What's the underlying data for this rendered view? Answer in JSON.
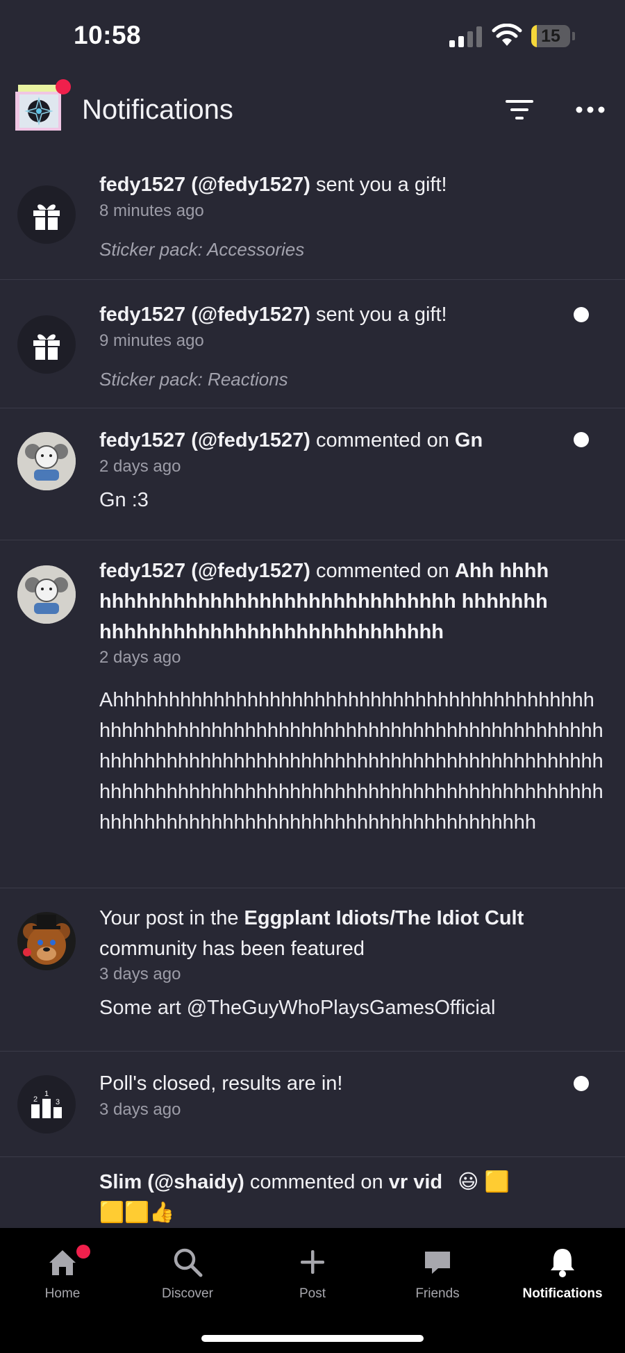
{
  "status_bar": {
    "time": "10:58",
    "battery": "15",
    "battery_level": 0.15
  },
  "header": {
    "title": "Notifications"
  },
  "notifications": [
    {
      "actor": "fedy1527 (@fedy1527)",
      "action": " sent you a gift!",
      "time": "8 minutes ago",
      "subtitle": "Sticker pack: Accessories",
      "icon": "gift-icon",
      "unread": false
    },
    {
      "actor": "fedy1527 (@fedy1527)",
      "action": " sent you a gift!",
      "time": "9 minutes ago",
      "subtitle": "Sticker pack: Reactions",
      "icon": "gift-icon",
      "unread": true
    },
    {
      "actor": "fedy1527 (@fedy1527)",
      "action": " commented on ",
      "target": "Gn",
      "time": "2 days ago",
      "body": "Gn :3",
      "icon": "user-avatar",
      "unread": true
    },
    {
      "actor": "fedy1527 (@fedy1527)",
      "action": " commented on ",
      "target": "Ahh hhhhhhhhhhhhhhhhhhhhhhhhhhhhhhhhh hhhhhhhhhhhhhhhhhhhhhhhhhhhhhhhhhhh",
      "time": "2 days ago",
      "body": "Ahhhhhhhhhhhhhhhhhhhhhhhhhhhhhhhhhhhhhhhhhhhhhhhhhhhhhhhhhhhhhhhhhhhhhhhhhhhhhhhhhhhhhhhhhhhhhhhhhhhhhhhhhhhhhhhhhhhhhhhhhhhhhhhhhhhhhhhhhhhhhhhhhhhhhhhhhhhhhhhhhhhhhhhhhhhhhhhhhhhhhhhhhhhhhhhhhhhhhhhhhhhhhhhhhhhhhhhhh",
      "icon": "user-avatar",
      "unread": false
    },
    {
      "prefix": "Your post in the ",
      "community": "Eggplant Idiots/The Idiot Cult",
      "suffix": " community has been featured",
      "time": "3 days ago",
      "body": "Some art @TheGuyWhoPlaysGamesOfficial",
      "icon": "bear-avatar",
      "unread": false
    },
    {
      "text": "Poll's closed, results are in!",
      "time": "3 days ago",
      "icon": "poll-icon",
      "unread": true
    },
    {
      "actor": "Slim (@shaidy)",
      "action": " commented on ",
      "target": "vr vid",
      "emoji_line1": "😃 🟨",
      "emoji_line2": "🟨🟨👍",
      "unread": false
    }
  ],
  "tabs": [
    {
      "label": "Home",
      "icon": "home-icon",
      "active": false,
      "badge": true
    },
    {
      "label": "Discover",
      "icon": "search-icon",
      "active": false
    },
    {
      "label": "Post",
      "icon": "plus-icon",
      "active": false
    },
    {
      "label": "Friends",
      "icon": "chat-icon",
      "active": false
    },
    {
      "label": "Notifications",
      "icon": "bell-icon",
      "active": true
    }
  ]
}
